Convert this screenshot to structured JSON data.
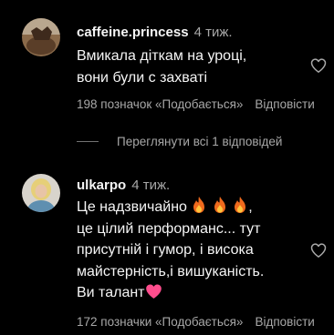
{
  "comments": [
    {
      "username": "caffeine.princess",
      "time": "4 тиж.",
      "lines": [
        "Вмикала діткам на уроці,",
        "вони були с захваті"
      ],
      "likes": "198 позначок «Подобається»",
      "reply": "Відповісти"
    },
    {
      "username": "ulkarpo",
      "time": "4 тиж.",
      "line1_text": "Це надзвичайно",
      "line1_emoji": [
        "fire-emoji",
        "fire-emoji",
        "fire-emoji"
      ],
      "line1_suffix": ",",
      "lines_rest": [
        "це цілий перформанс... тут",
        "присутній і гумор, і висока",
        "майстерність,і вишуканість."
      ],
      "line_last_text": "Ви талант",
      "line_last_emoji": "pink-heart-emoji",
      "likes": "172 позначки «Подобається»",
      "reply": "Відповісти"
    }
  ],
  "view_replies": "Переглянути всі 1 відповідей",
  "icons": {
    "like": "heart-outline-icon"
  },
  "colors": {
    "background": "#000000",
    "primary_text": "#f5f5f5",
    "secondary_text": "#a8a8a8",
    "pink_heart": "#ff4d8d"
  }
}
